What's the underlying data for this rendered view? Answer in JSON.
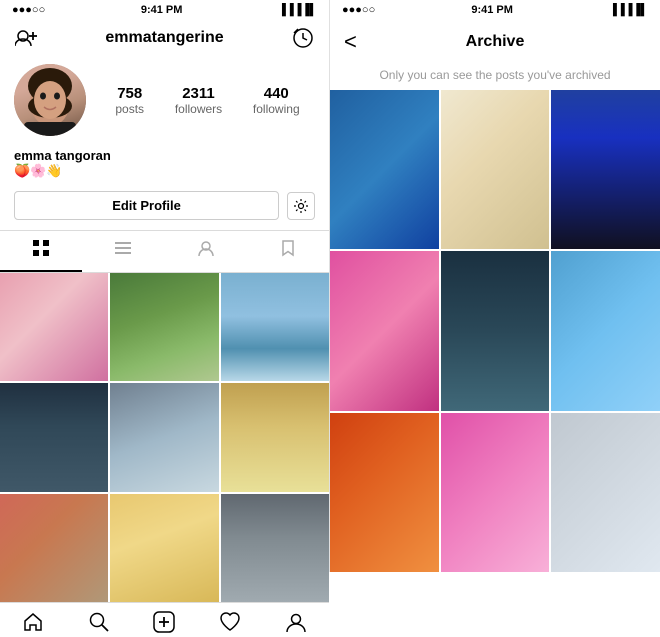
{
  "left": {
    "statusBar": {
      "signal": "●●●○○",
      "time": "9:41 PM",
      "battery": "▐▐▐▐▌"
    },
    "username": "emmatangerine",
    "stats": {
      "posts": {
        "number": "758",
        "label": "posts"
      },
      "followers": {
        "number": "2311",
        "label": "followers"
      },
      "following": {
        "number": "440",
        "label": "following"
      }
    },
    "bioName": "emma tangoran",
    "bioEmoji": "🍑🌸👋",
    "editProfileLabel": "Edit Profile",
    "tabs": [
      "grid",
      "list",
      "person",
      "bookmark"
    ],
    "bottomNav": [
      "home",
      "search",
      "add",
      "heart",
      "profile"
    ]
  },
  "right": {
    "statusBar": {
      "signal": "●●●○○",
      "time": "9:41 PM",
      "battery": "▐▐▐▐▌"
    },
    "title": "Archive",
    "subtitle": "Only you can see the posts you've archived",
    "backLabel": "<"
  }
}
